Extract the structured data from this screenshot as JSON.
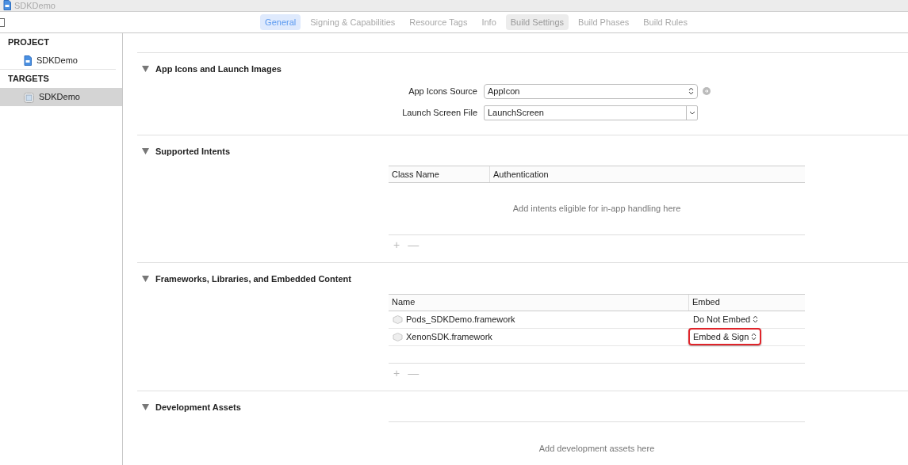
{
  "window": {
    "title": "SDKDemo"
  },
  "tabs": [
    {
      "label": "General",
      "selected": true,
      "hovered": false
    },
    {
      "label": "Signing & Capabilities",
      "selected": false,
      "hovered": false
    },
    {
      "label": "Resource Tags",
      "selected": false,
      "hovered": false
    },
    {
      "label": "Info",
      "selected": false,
      "hovered": false
    },
    {
      "label": "Build Settings",
      "selected": false,
      "hovered": true
    },
    {
      "label": "Build Phases",
      "selected": false,
      "hovered": false
    },
    {
      "label": "Build Rules",
      "selected": false,
      "hovered": false
    }
  ],
  "sidebar": {
    "groups": [
      {
        "heading": "PROJECT",
        "items": [
          {
            "label": "SDKDemo",
            "kind": "project",
            "selected": false
          }
        ]
      },
      {
        "heading": "TARGETS",
        "items": [
          {
            "label": "SDKDemo",
            "kind": "target",
            "selected": true
          }
        ]
      }
    ]
  },
  "sections": [
    {
      "kind": "form",
      "title": "App Icons and Launch Images",
      "expanded": true,
      "fields": [
        {
          "label": "App Icons Source",
          "value": "AppIcon",
          "kind": "popup"
        },
        {
          "label": "Launch Screen File",
          "value": "LaunchScreen",
          "kind": "combo"
        }
      ]
    },
    {
      "kind": "table",
      "title": "Supported Intents",
      "expanded": true,
      "columns": [
        "Class Name",
        "Authentication"
      ],
      "empty_text": "Add intents eligible for in-app handling here",
      "add_button": "+",
      "remove_button": "—"
    },
    {
      "kind": "table",
      "title": "Frameworks, Libraries, and Embedded Content",
      "expanded": true,
      "columns": [
        "Name",
        "Embed"
      ],
      "rows": [
        {
          "name": "Pods_SDKDemo.framework",
          "embed": "Do Not Embed",
          "highlighted": false
        },
        {
          "name": "XenonSDK.framework",
          "embed": "Embed & Sign",
          "highlighted": true
        }
      ],
      "add_button": "+",
      "remove_button": "—"
    },
    {
      "kind": "list",
      "title": "Development Assets",
      "expanded": true,
      "empty_text": "Add development assets here"
    }
  ]
}
